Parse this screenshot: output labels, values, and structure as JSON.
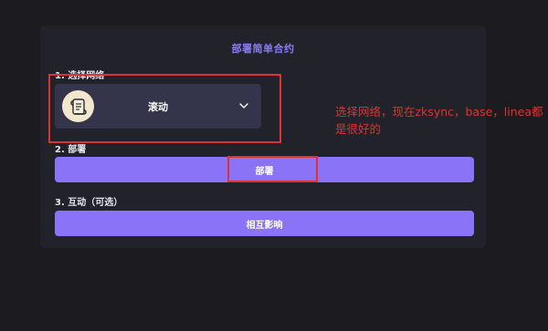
{
  "card": {
    "title": "部署简单合约"
  },
  "steps": {
    "select_network_label": "1. 选择网络",
    "deploy_label": "2. 部署",
    "interact_label": "3. 互动（可选）"
  },
  "network_select": {
    "selected": "滚动",
    "logo_icon": "scroll-logo-icon",
    "dropdown_icon": "chevron-down-icon"
  },
  "buttons": {
    "deploy": "部署",
    "interact": "相互影响"
  },
  "annotation": {
    "text": "选择网络，现在zksync，base，linea都是很好的"
  },
  "colors": {
    "background": "#1b1b20",
    "card": "#22222b",
    "accent": "#8a73f7",
    "title": "#8b7cf6",
    "select_bg": "#34344a",
    "annotation": "#e0322e"
  }
}
